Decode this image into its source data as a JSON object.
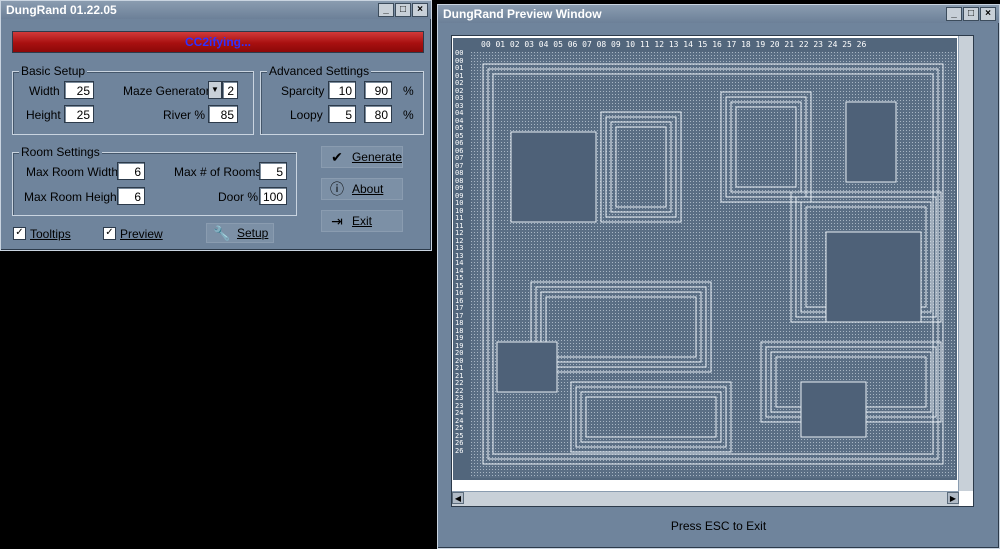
{
  "main_window": {
    "title": "DungRand 01.22.05",
    "status": "CC2ifying...",
    "basic_setup": {
      "title": "Basic Setup",
      "width_label": "Width",
      "width_value": "25",
      "height_label": "Height",
      "height_value": "25",
      "maze_label": "Maze Generator",
      "maze_value": "2",
      "river_label": "River %",
      "river_value": "85"
    },
    "advanced": {
      "title": "Advanced Settings",
      "sparcity_label": "Sparcity",
      "sparcity_min": "10",
      "sparcity_max": "90",
      "loopy_label": "Loopy",
      "loopy_min": "5",
      "loopy_max": "80",
      "percent": "%"
    },
    "room": {
      "title": "Room Settings",
      "max_w_label": "Max Room Width",
      "max_w_value": "6",
      "max_h_label": "Max Room Height",
      "max_h_value": "6",
      "max_rooms_label": "Max # of Rooms",
      "max_rooms_value": "5",
      "door_label": "Door %",
      "door_value": "100"
    },
    "buttons": {
      "generate": "Generate",
      "about": "About",
      "exit": "Exit",
      "setup": "Setup"
    },
    "checks": {
      "tooltips": "Tooltips",
      "tooltips_checked": true,
      "preview": "Preview",
      "preview_checked": true
    },
    "controls": {
      "minimize": "_",
      "maximize": "□",
      "close": "×"
    }
  },
  "preview_window": {
    "title": "DungRand Preview Window",
    "columns": [
      "00",
      "01",
      "02",
      "03",
      "04",
      "05",
      "06",
      "07",
      "08",
      "09",
      "10",
      "11",
      "12",
      "13",
      "14",
      "15",
      "16",
      "17",
      "18",
      "19",
      "20",
      "21",
      "22",
      "23",
      "24",
      "25",
      "26"
    ],
    "rows": [
      "00",
      "00",
      "01",
      "01",
      "02",
      "02",
      "03",
      "03",
      "04",
      "04",
      "05",
      "05",
      "06",
      "06",
      "07",
      "07",
      "08",
      "08",
      "09",
      "09",
      "10",
      "10",
      "11",
      "11",
      "12",
      "12",
      "13",
      "13",
      "14",
      "14",
      "15",
      "15",
      "16",
      "16",
      "17",
      "17",
      "18",
      "18",
      "19",
      "19",
      "20",
      "20",
      "21",
      "21",
      "22",
      "22",
      "23",
      "23",
      "24",
      "24",
      "25",
      "25",
      "26",
      "26"
    ],
    "footer": "Press ESC to Exit",
    "controls": {
      "minimize": "_",
      "maximize": "□",
      "close": "×"
    },
    "colors": {
      "map_bg": "#52667c",
      "wall": "#e8eef4",
      "room_fill": "#4e6178"
    }
  }
}
